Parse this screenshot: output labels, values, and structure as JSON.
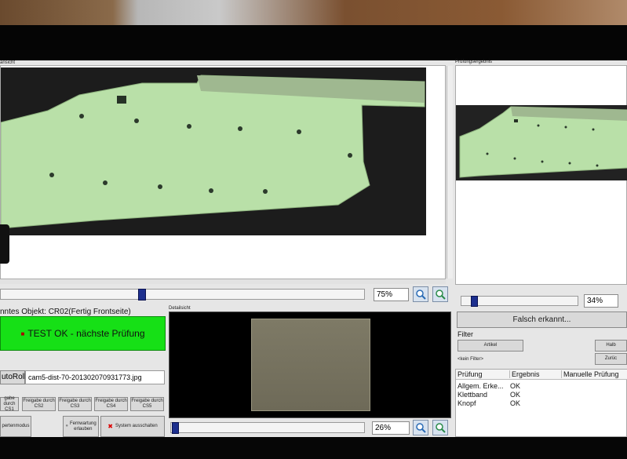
{
  "views": {
    "left_title": "ansicht",
    "right_title": "Prüfungsergebnis",
    "detail_title": "Detailsicht"
  },
  "zoom": {
    "main": "75%",
    "right": "34%",
    "detail": "26%"
  },
  "object_label": "nntes Objekt: CR02(Fertig Frontseite)",
  "status": {
    "text": "TEST OK - nächste Prüfung",
    "color": "#16e016"
  },
  "file": {
    "button": "utoRoll",
    "name": "cam5-dist-70-201302070931773.jpg"
  },
  "release_buttons": [
    {
      "line1": "gabe durch",
      "line2": "CS1"
    },
    {
      "line1": "Freigabe durch",
      "line2": "CS2"
    },
    {
      "line1": "Freigabe durch",
      "line2": "CS3"
    },
    {
      "line1": "Freigabe durch",
      "line2": "CS4"
    },
    {
      "line1": "Freigabe durch",
      "line2": "CS5"
    }
  ],
  "bottom_buttons": {
    "expert": "pertenmodus",
    "remote_line1": "Fernwartung",
    "remote_line2": "erlauben",
    "shutdown": "System ausschalten"
  },
  "right_panel": {
    "false_detected": "Falsch erkannt...",
    "filter_title": "Filter",
    "artikel": "Artikel",
    "kein_filter": "<kein Filter>",
    "halb": "Halb",
    "zuruck": "Zurüc"
  },
  "results": {
    "headers": [
      "Prüfung",
      "Ergebnis",
      "Manuelle Prüfung"
    ],
    "rows": [
      [
        "Allgem. Erke...",
        "OK",
        ""
      ],
      [
        "Klettband",
        "OK",
        ""
      ],
      [
        "Knopf",
        "OK",
        ""
      ]
    ]
  }
}
